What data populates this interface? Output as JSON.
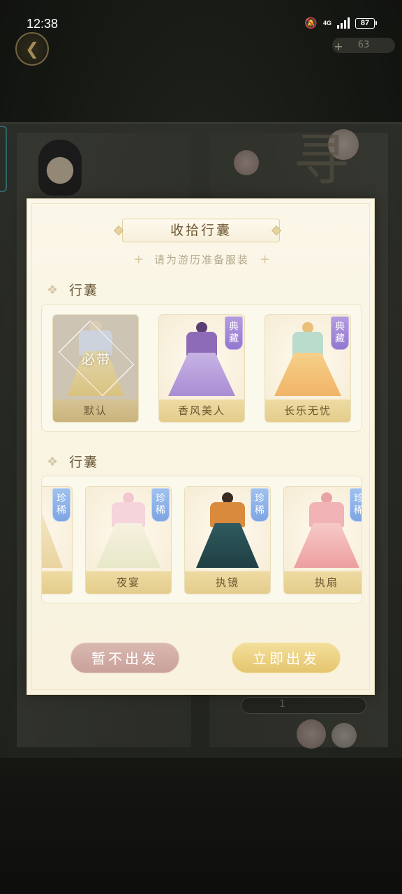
{
  "status_bar": {
    "time": "12:38",
    "network": "4G",
    "battery": "87"
  },
  "hud": {
    "currency_value": "63",
    "currency_plus": "+"
  },
  "background": {
    "title_glyph": "寻",
    "pager_value": "1"
  },
  "dialog": {
    "title": "收拾行囊",
    "subtitle": "请为游历准备服装",
    "section1": {
      "label": "行囊",
      "cards": [
        {
          "name": "默认",
          "badge": "必带",
          "tag": ""
        },
        {
          "name": "香风美人",
          "badge": "",
          "tag": "典藏"
        },
        {
          "name": "长乐无忧",
          "badge": "",
          "tag": "典藏"
        }
      ]
    },
    "section2": {
      "label": "行囊",
      "cards": [
        {
          "name": "",
          "tag": "珍稀"
        },
        {
          "name": "夜宴",
          "tag": "珍稀"
        },
        {
          "name": "执镜",
          "tag": "珍稀"
        },
        {
          "name": "执扇",
          "tag": "珍稀"
        }
      ]
    },
    "cancel_label": "暂不出发",
    "confirm_label": "立即出发"
  },
  "colors": {
    "rarity_purple": "#9277cf",
    "rarity_blue": "#7ea5e3",
    "button_cancel": "#c9a29a",
    "button_confirm": "#e5c56f"
  }
}
